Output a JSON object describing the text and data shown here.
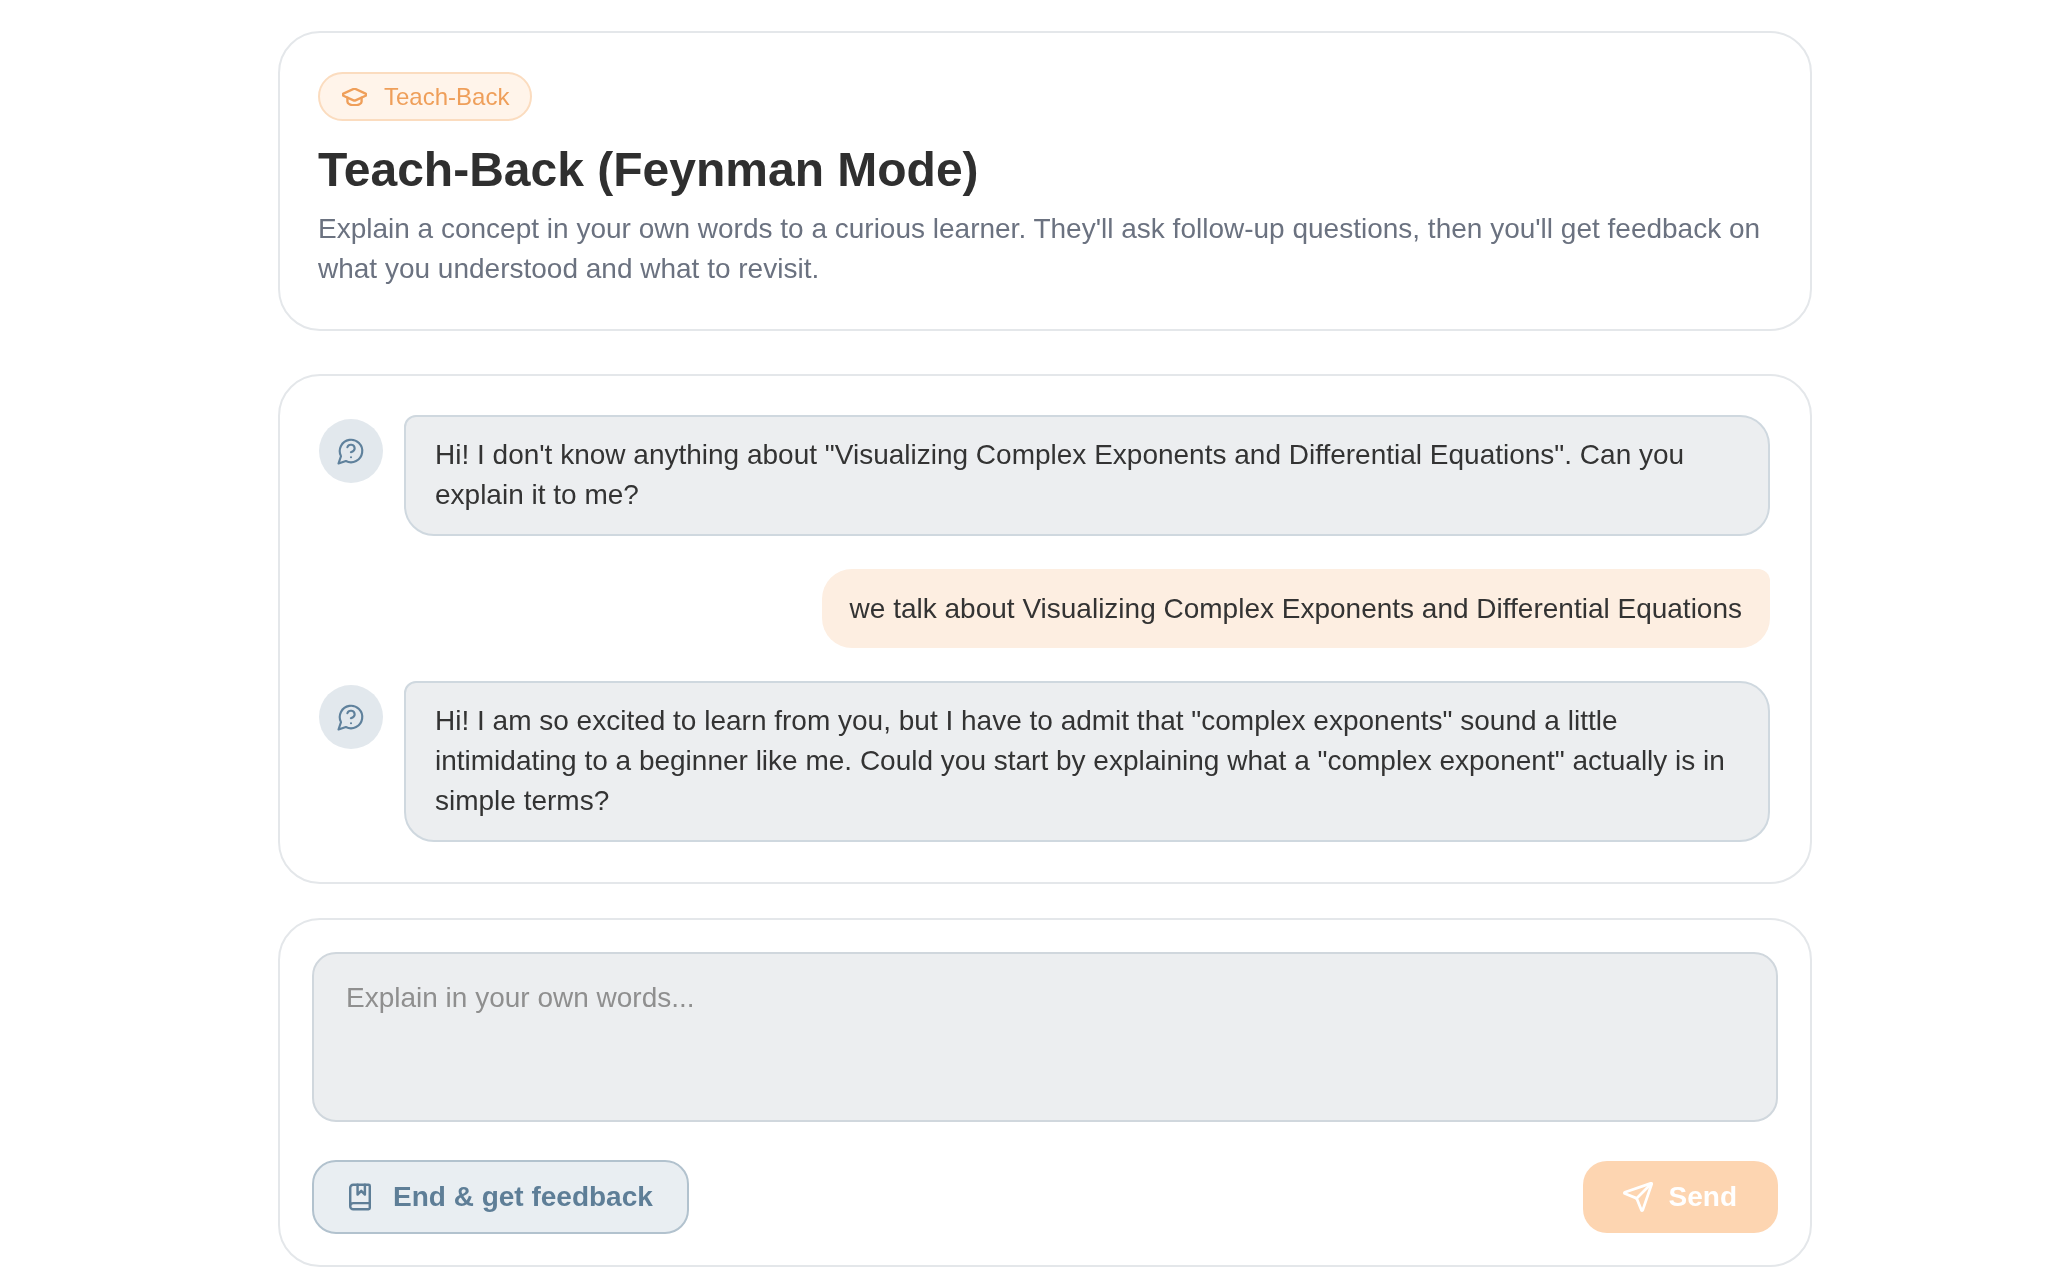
{
  "header": {
    "badge": {
      "label": "Teach-Back"
    },
    "title": "Teach-Back (Feynman Mode)",
    "description": "Explain a concept in your own words to a curious learner. They'll ask follow-up questions, then you'll get feedback on what you understood and what to revisit."
  },
  "messages": [
    {
      "kind": "learner",
      "text": "Hi! I don't know anything about \"Visualizing Complex Exponents and Differential Equations\". Can you explain it to me?"
    },
    {
      "kind": "user",
      "text": "we talk about Visualizing Complex Exponents and Differential Equations"
    },
    {
      "kind": "learner",
      "text": "Hi! I am so excited to learn from you, but I have to admit that \"complex exponents\" sound a little intimidating to a beginner like me. Could you start by explaining what a \"complex exponent\" actually is in simple terms?"
    }
  ],
  "composer": {
    "placeholder": "Explain in your own words...",
    "buttons": [
      {
        "kind": "secondary",
        "label": "End & get feedback",
        "disabled": false
      },
      {
        "kind": "primary",
        "label": "Send",
        "disabled": true
      }
    ]
  }
}
